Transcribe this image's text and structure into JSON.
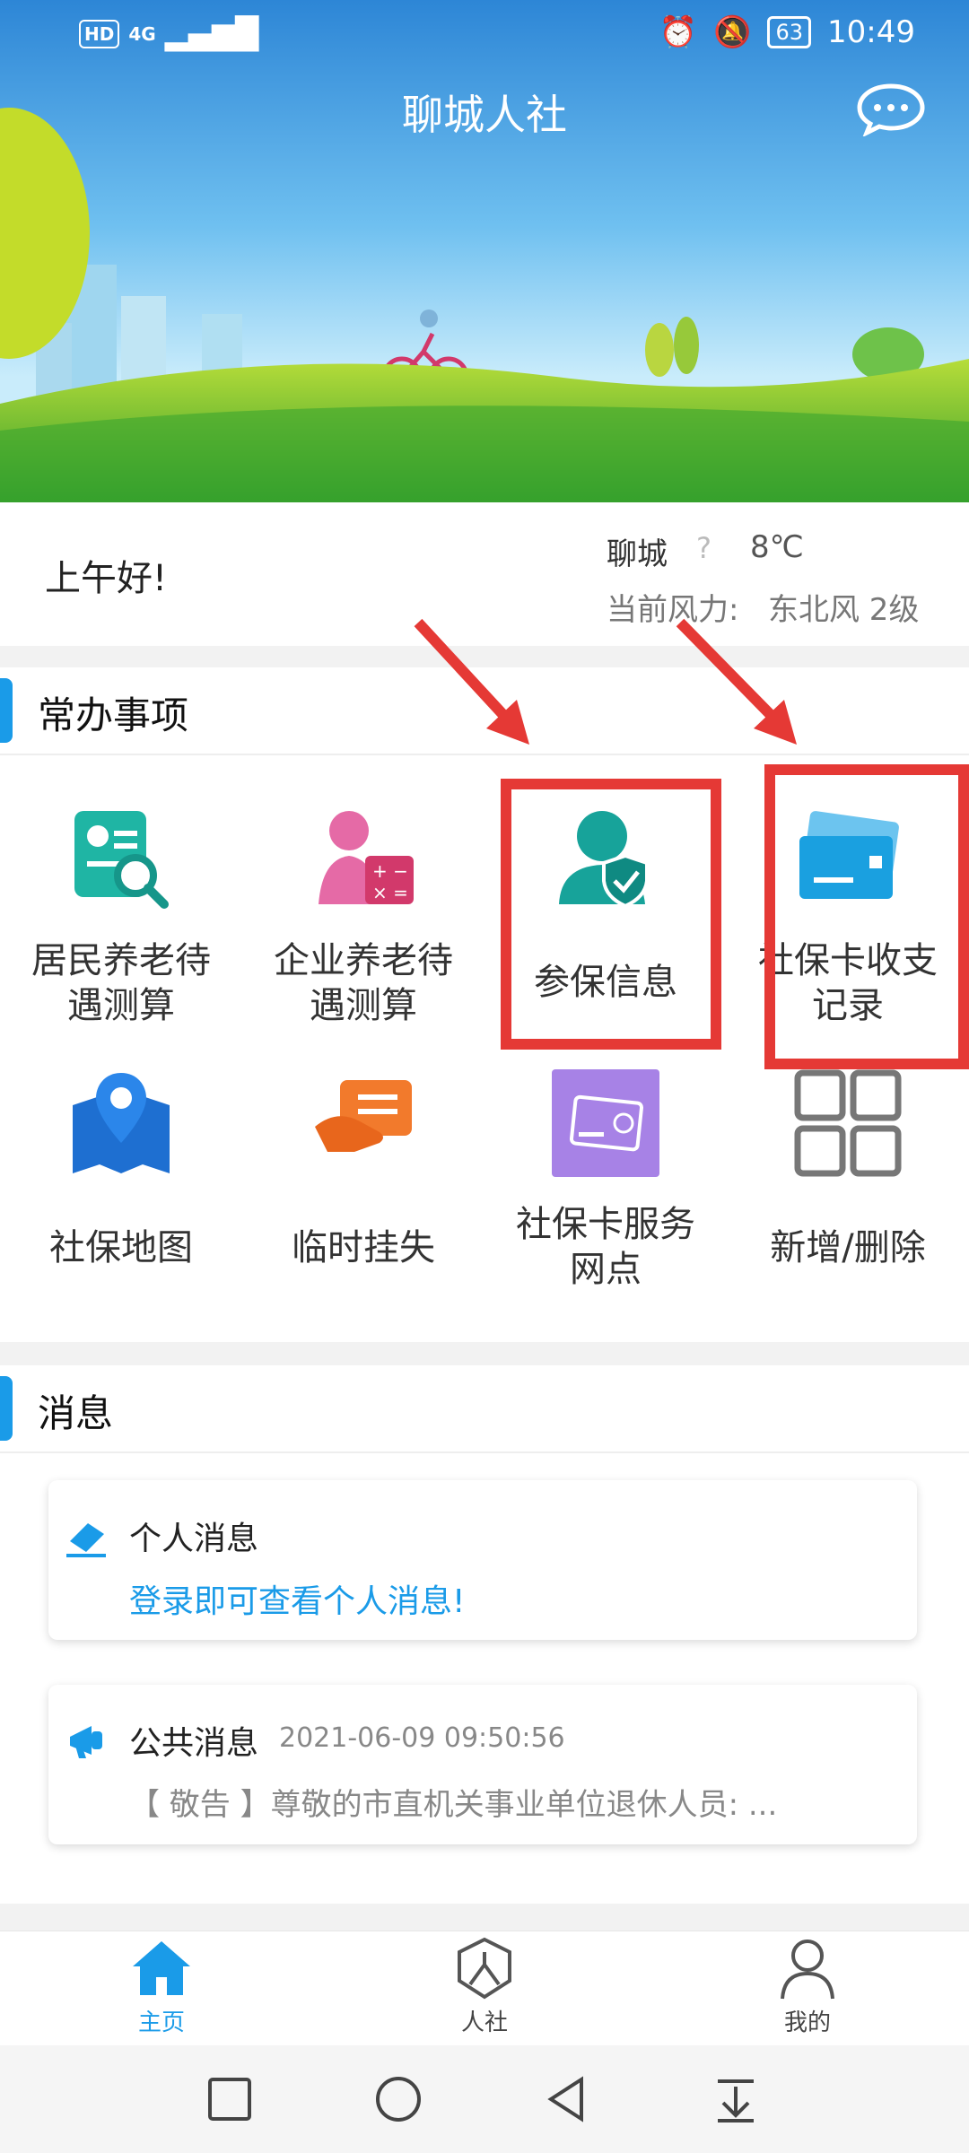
{
  "status_bar": {
    "network": "HD",
    "signal": "4G",
    "battery": "63",
    "time": "10:49"
  },
  "header": {
    "title": "聊城人社"
  },
  "greeting": {
    "text": "上午好!",
    "city": "聊城",
    "weather_icon": "?",
    "temperature": "8℃",
    "wind_label": "当前风力:",
    "wind_value": "东北风 2级"
  },
  "services": {
    "title": "常办事项",
    "items": [
      {
        "line1": "居民养老待",
        "line2": "遇测算",
        "icon": "resident-pension-calc-icon"
      },
      {
        "line1": "企业养老待",
        "line2": "遇测算",
        "icon": "enterprise-pension-calc-icon"
      },
      {
        "line1": "参保信息",
        "line2": "",
        "icon": "insurance-info-icon"
      },
      {
        "line1": "社保卡收支",
        "line2": "记录",
        "icon": "card-transactions-icon"
      },
      {
        "line1": "社保地图",
        "line2": "",
        "icon": "map-icon"
      },
      {
        "line1": "临时挂失",
        "line2": "",
        "icon": "temporary-loss-report-icon"
      },
      {
        "line1": "社保卡服务",
        "line2": "网点",
        "icon": "card-service-outlet-icon"
      },
      {
        "line1": "新增/删除",
        "line2": "",
        "icon": "grid-icon"
      }
    ]
  },
  "messages": {
    "title": "消息",
    "personal": {
      "title": "个人消息",
      "link": "登录即可查看个人消息!"
    },
    "public": {
      "title": "公共消息",
      "time": "2021-06-09 09:50:56",
      "preview": "【 敬告 】尊敬的市直机关事业单位退休人员: ..."
    }
  },
  "bottom_nav": [
    {
      "label": "主页",
      "icon": "home-icon",
      "active": true
    },
    {
      "label": "人社",
      "icon": "hrss-icon",
      "active": false
    },
    {
      "label": "我的",
      "icon": "profile-icon",
      "active": false
    }
  ],
  "colors": {
    "accent": "#1a9be8",
    "highlight": "#e53935"
  }
}
